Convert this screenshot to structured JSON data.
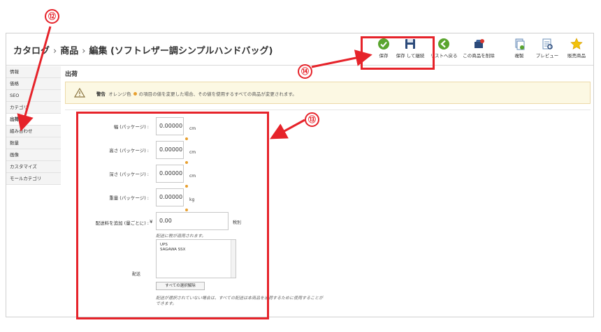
{
  "breadcrumb": {
    "level1": "カタログ",
    "level2": "商品",
    "level3": "編集 (ソフトレザー調シンプルハンドバッグ)"
  },
  "toolbar": [
    {
      "name": "save-button",
      "icon": "check-circle-icon",
      "label": "保存",
      "color": "#5aa52e"
    },
    {
      "name": "save-and-stay-button",
      "icon": "floppy-disk-icon",
      "label": "保存 して継続",
      "color": "#2b4a7a"
    },
    {
      "name": "back-to-list-button",
      "icon": "back-arrow-icon",
      "label": "リストへ戻る",
      "color": "#5aa52e"
    },
    {
      "name": "delete-product-button",
      "icon": "delete-product-icon",
      "label": "この商品を削除",
      "color": "#2b4a7a"
    },
    {
      "name": "duplicate-button",
      "icon": "duplicate-icon",
      "label": "複製",
      "color": "#6b8fb8"
    },
    {
      "name": "preview-button",
      "icon": "preview-icon",
      "label": "プレビュー",
      "color": "#6b8fb8"
    },
    {
      "name": "sales-button",
      "icon": "star-icon",
      "label": "販売商品",
      "color": "#f2c20a"
    }
  ],
  "sidebar": {
    "items": [
      {
        "label": "情報"
      },
      {
        "label": "価格"
      },
      {
        "label": "SEO"
      },
      {
        "label": "カテゴリ"
      },
      {
        "label": "出荷"
      },
      {
        "label": "組み合わせ"
      },
      {
        "label": "数量"
      },
      {
        "label": "画像"
      },
      {
        "label": "カスタマイズ"
      },
      {
        "label": "モールカテゴリ"
      }
    ],
    "active_index": 4
  },
  "section": {
    "title": "出荷"
  },
  "warning": {
    "prefix": "警告",
    "color_word": "オレンジ色",
    "text": "の項目の値を変更した場合、その値を使用するすべての商品が変更されます。",
    "accent": "#e8a030"
  },
  "form": {
    "width": {
      "label": "幅 (パッケージ) :",
      "value": "0.00000",
      "unit": "cm"
    },
    "height": {
      "label": "高さ (パッケージ) :",
      "value": "0.00000",
      "unit": "cm"
    },
    "depth": {
      "label": "深さ (パッケージ) :",
      "value": "0.00000",
      "unit": "cm"
    },
    "weight": {
      "label": "重量 (パッケージ) :",
      "value": "0.00000",
      "unit": "kg"
    },
    "extra_shipping": {
      "label": "配送料を追加 (量ごとに) :",
      "currency": "¥",
      "value": "0.00",
      "tax": "税別",
      "hint": "配送に税が適用されます。"
    },
    "carriers": {
      "label": "配送",
      "options": [
        "UPS",
        "SAGAWA SSX"
      ],
      "clear_label": "すべての選択解除",
      "hint_line1": "配送が選択されていない場合は、すべての配送は本商品を出荷するために使用することが",
      "hint_line2": "できます。"
    }
  },
  "annotations": {
    "badge12": "⑫",
    "badge13": "⑬",
    "badge14": "⑭",
    "color": "#e6232a"
  }
}
